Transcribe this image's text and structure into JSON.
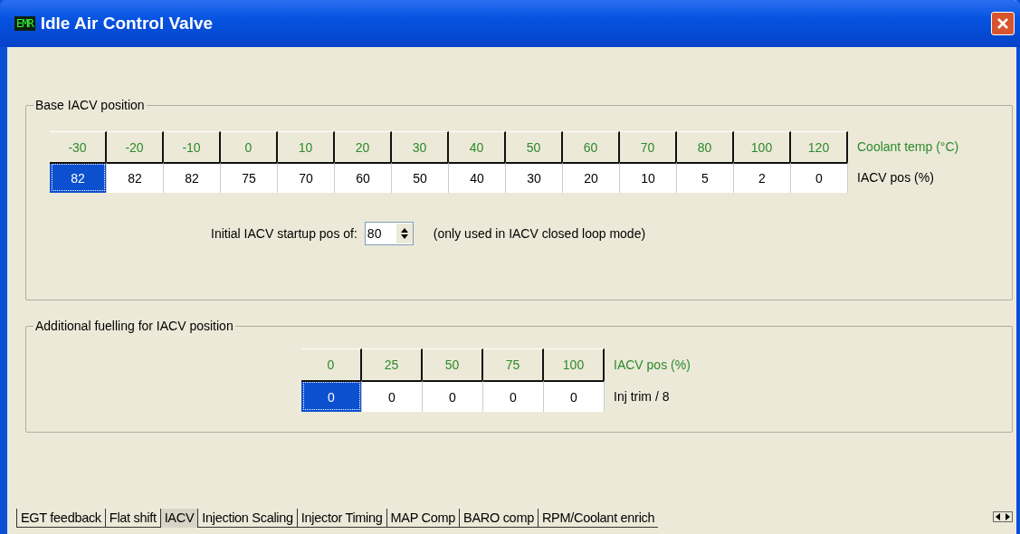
{
  "window": {
    "title": "Idle Air Control Valve",
    "logo": "EMR"
  },
  "base_group": {
    "title": "Base IACV position",
    "header": [
      "-30",
      "-20",
      "-10",
      "0",
      "10",
      "20",
      "30",
      "40",
      "50",
      "60",
      "70",
      "80",
      "100",
      "120"
    ],
    "header_label": "Coolant temp (°C)",
    "cells": [
      {
        "value": "82",
        "selected": true
      },
      {
        "value": "82",
        "selected": false
      },
      {
        "value": "82",
        "selected": false
      },
      {
        "value": "75",
        "selected": false
      },
      {
        "value": "70",
        "selected": false
      },
      {
        "value": "60",
        "selected": false
      },
      {
        "value": "50",
        "selected": false
      },
      {
        "value": "40",
        "selected": false
      },
      {
        "value": "30",
        "selected": false
      },
      {
        "value": "20",
        "selected": false
      },
      {
        "value": "10",
        "selected": false
      },
      {
        "value": "5",
        "selected": false
      },
      {
        "value": "2",
        "selected": false
      },
      {
        "value": "0",
        "selected": false
      }
    ],
    "row_label": "IACV pos (%)",
    "startup_label": "Initial IACV startup pos of:",
    "startup_value": "80",
    "startup_note": "(only used in IACV closed loop mode)"
  },
  "fuel_group": {
    "title": "Additional fuelling for IACV position",
    "header": [
      "0",
      "25",
      "50",
      "75",
      "100"
    ],
    "header_label": "IACV pos (%)",
    "cells": [
      {
        "value": "0",
        "selected": true
      },
      {
        "value": "0",
        "selected": false
      },
      {
        "value": "0",
        "selected": false
      },
      {
        "value": "0",
        "selected": false
      },
      {
        "value": "0",
        "selected": false
      }
    ],
    "row_label": "Inj trim / 8"
  },
  "tabs": [
    {
      "label": "EGT feedback",
      "selected": false
    },
    {
      "label": "Flat shift",
      "selected": false
    },
    {
      "label": "IACV",
      "selected": true
    },
    {
      "label": "Injection Scaling",
      "selected": false
    },
    {
      "label": "Injector Timing",
      "selected": false
    },
    {
      "label": "MAP Comp",
      "selected": false
    },
    {
      "label": "BARO comp",
      "selected": false
    },
    {
      "label": "RPM/Coolant enrich",
      "selected": false
    }
  ]
}
